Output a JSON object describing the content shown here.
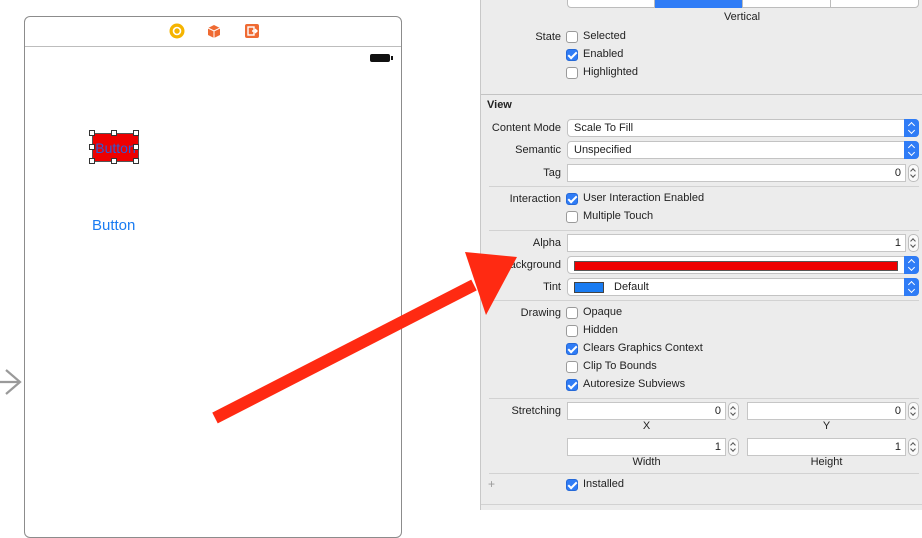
{
  "canvas": {
    "button_selected_label": "Button",
    "button_plain_label": "Button",
    "dock_icons": [
      "view-controller-icon",
      "first-responder-icon",
      "exit-icon"
    ],
    "colors": {
      "selected_button_bg": "#ee0000",
      "plain_button_text": "#1a7cf2",
      "arrow": "#ff2a12"
    }
  },
  "inspector": {
    "top": {
      "segment_caption": "Vertical",
      "state_label": "State",
      "state_options": [
        {
          "label": "Selected",
          "checked": false
        },
        {
          "label": "Enabled",
          "checked": true
        },
        {
          "label": "Highlighted",
          "checked": false
        }
      ]
    },
    "view": {
      "header": "View",
      "content_mode_label": "Content Mode",
      "content_mode_value": "Scale To Fill",
      "semantic_label": "Semantic",
      "semantic_value": "Unspecified",
      "tag_label": "Tag",
      "tag_value": "0",
      "interaction_label": "Interaction",
      "interaction_options": [
        {
          "label": "User Interaction Enabled",
          "checked": true
        },
        {
          "label": "Multiple Touch",
          "checked": false
        }
      ],
      "alpha_label": "Alpha",
      "alpha_value": "1",
      "background_label": "Background",
      "background_color": "#ee0000",
      "tint_label": "Tint",
      "tint_value": "Default",
      "tint_color": "#1a7cf2",
      "drawing_label": "Drawing",
      "drawing_options": [
        {
          "label": "Opaque",
          "checked": false
        },
        {
          "label": "Hidden",
          "checked": false
        },
        {
          "label": "Clears Graphics Context",
          "checked": true
        },
        {
          "label": "Clip To Bounds",
          "checked": false
        },
        {
          "label": "Autoresize Subviews",
          "checked": true
        }
      ],
      "stretching_label": "Stretching",
      "stretch_x": "0",
      "stretch_y": "0",
      "x_caption": "X",
      "y_caption": "Y",
      "stretch_width": "1",
      "stretch_height": "1",
      "width_caption": "Width",
      "height_caption": "Height",
      "installed_label": "Installed",
      "installed_checked": true
    }
  }
}
